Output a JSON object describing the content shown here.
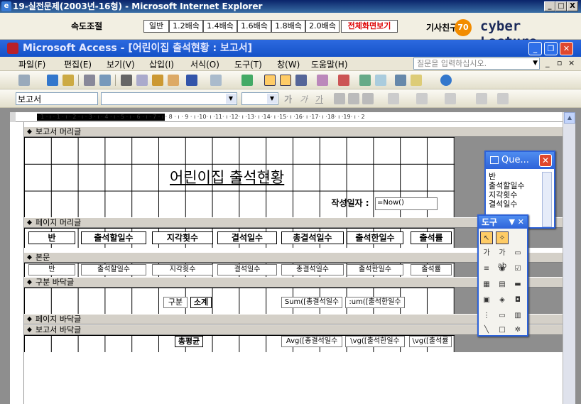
{
  "ie_window": {
    "title": "19-실전문제(2003년-16형) - Microsoft Internet Explorer",
    "controls": [
      "_",
      "□",
      "X"
    ]
  },
  "lecture_bar": {
    "speed_label": "속도조절",
    "speed_buttons": [
      "일반",
      "1.2배속",
      "1.4배속",
      "1.6배속",
      "1.8배속",
      "2.0배속",
      "전체화면보기"
    ],
    "logo_korean": "기사친구",
    "logo_text": "cyber Lecture"
  },
  "access_window": {
    "title": "Microsoft Access - [어린이집 출석현황 : 보고서]"
  },
  "menu": {
    "items": [
      "파일(F)",
      "편집(E)",
      "보기(V)",
      "삽입(I)",
      "서식(O)",
      "도구(T)",
      "창(W)",
      "도움말(H)"
    ],
    "help_placeholder": "질문을 입력하십시오.",
    "mdi_controls": [
      "_",
      "▫",
      "×"
    ]
  },
  "format_toolbar": {
    "object_combo": "보고서",
    "bold": "가",
    "italic": "가",
    "underline": "가"
  },
  "ruler": {
    "marks": "· 1 · ı · 1 · ı · 2 · ı · 3 · ı · 4 · ı · 5 · ı · 6 · ı · 7 · ı · 8 · ı · 9 · ı ·10· ı ·11· ı ·12· ı ·13· ı ·14· ı ·15· ı ·16· ı ·17· ı ·18· ı ·19· ı · 2"
  },
  "report": {
    "bands": {
      "report_header": "보고서 머리글",
      "page_header": "페이지 머리글",
      "detail": "본문",
      "group_footer": "구분 바닥글",
      "page_footer": "페이지 바닥글",
      "report_footer": "보고서 바닥글"
    },
    "title": "어린이집 출석현황",
    "date_label": "작성일자 :",
    "date_value": "=Now()",
    "page_header_labels": [
      "반",
      "출석할일수",
      "지각횟수",
      "결석일수",
      "총결석일수",
      "출석한일수",
      "출석률"
    ],
    "detail_fields": [
      "반",
      "출석할일수",
      "지각횟수",
      "결석일수",
      "총결석일수",
      "출석한일수",
      "출석률"
    ],
    "group_footer": {
      "gubun": "구분",
      "subtotal": "소계",
      "sum1": "Sum([총결석일수",
      "sum2": ":um([출석한일수"
    },
    "report_footer": {
      "average": "총평균",
      "avg1": "Avg([총결석일수",
      "avg2": "\\vg([출석한일수",
      "avg3": "\\vg([출석률"
    }
  },
  "field_list": {
    "title": "Que...",
    "items": [
      "반",
      "출석할일수",
      "지각횟수",
      "결석일수"
    ]
  },
  "toolbox": {
    "title": "도구",
    "label_tool": "가",
    "textbox_tool": "가ab"
  }
}
